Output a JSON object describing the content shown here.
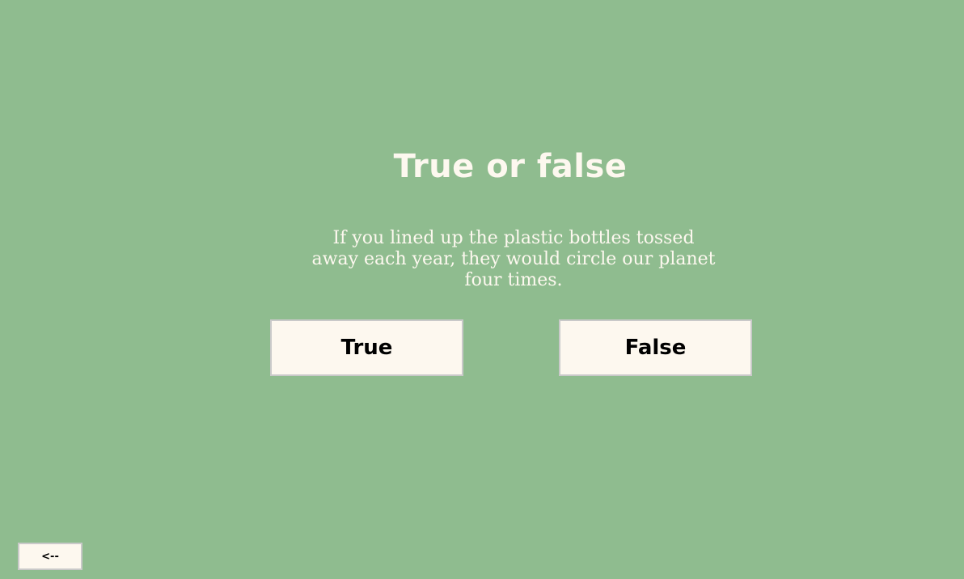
{
  "quiz": {
    "title": "True or false",
    "question": "If you lined up the plastic bottles tossed away each year, they would circle our planet four times.",
    "true_label": "True",
    "false_label": "False"
  },
  "nav": {
    "back_label": "<--"
  },
  "colors": {
    "background": "#8fbc8f",
    "button_fill": "#fdf8ef",
    "title_text": "#fdf8ef"
  }
}
